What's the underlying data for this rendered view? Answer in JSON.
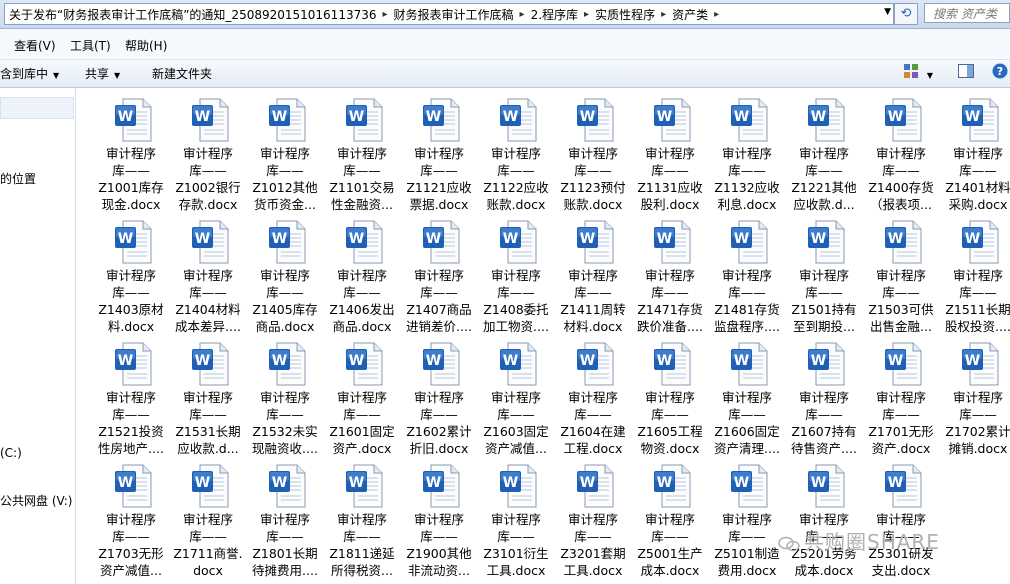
{
  "breadcrumb": [
    "关于发布“财务报表审计工作底稿”的通知_2508920151016113736",
    "财务报表审计工作底稿",
    "2.程序库",
    "实质性程序",
    "资产类"
  ],
  "search": {
    "placeholder": "搜索 资产类"
  },
  "menu": {
    "view": "查看(V)",
    "tools": "工具(T)",
    "help": "帮助(H)"
  },
  "toolbar": {
    "include": "含到库中",
    "share": "共享",
    "new_folder": "新建文件夹"
  },
  "nav": {
    "location": "的位置",
    "drive_c": "(C:)",
    "public_drive": "公共网盘 (V:)"
  },
  "watermark": "共购圈SHARE",
  "files": [
    {
      "l1": "审计程序",
      "l2": "库——",
      "l3": "Z1001库存",
      "l4": "现金.docx"
    },
    {
      "l1": "审计程序",
      "l2": "库——",
      "l3": "Z1002银行",
      "l4": "存款.docx"
    },
    {
      "l1": "审计程序",
      "l2": "库——",
      "l3": "Z1012其他",
      "l4": "货币资金..."
    },
    {
      "l1": "审计程序",
      "l2": "库——",
      "l3": "Z1101交易",
      "l4": "性金融资..."
    },
    {
      "l1": "审计程序",
      "l2": "库——",
      "l3": "Z1121应收",
      "l4": "票据.docx"
    },
    {
      "l1": "审计程序",
      "l2": "库——",
      "l3": "Z1122应收",
      "l4": "账款.docx"
    },
    {
      "l1": "审计程序",
      "l2": "库——",
      "l3": "Z1123预付",
      "l4": "账款.docx"
    },
    {
      "l1": "审计程序",
      "l2": "库——",
      "l3": "Z1131应收",
      "l4": "股利.docx"
    },
    {
      "l1": "审计程序",
      "l2": "库——",
      "l3": "Z1132应收",
      "l4": "利息.docx"
    },
    {
      "l1": "审计程序",
      "l2": "库——",
      "l3": "Z1221其他",
      "l4": "应收款.d..."
    },
    {
      "l1": "审计程序",
      "l2": "库——",
      "l3": "Z1400存货",
      "l4": "（报表项..."
    },
    {
      "l1": "审计程序",
      "l2": "库——",
      "l3": "Z1401材料",
      "l4": "采购.docx"
    },
    {
      "l1": "审计程序",
      "l2": "库——",
      "l3": "Z1403原材",
      "l4": "料.docx"
    },
    {
      "l1": "审计程序",
      "l2": "库——",
      "l3": "Z1404材料",
      "l4": "成本差异...."
    },
    {
      "l1": "审计程序",
      "l2": "库——",
      "l3": "Z1405库存",
      "l4": "商品.docx"
    },
    {
      "l1": "审计程序",
      "l2": "库——",
      "l3": "Z1406发出",
      "l4": "商品.docx"
    },
    {
      "l1": "审计程序",
      "l2": "库——",
      "l3": "Z1407商品",
      "l4": "进销差价...."
    },
    {
      "l1": "审计程序",
      "l2": "库——",
      "l3": "Z1408委托",
      "l4": "加工物资...."
    },
    {
      "l1": "审计程序",
      "l2": "库——",
      "l3": "Z1411周转",
      "l4": "材料.docx"
    },
    {
      "l1": "审计程序",
      "l2": "库——",
      "l3": "Z1471存货",
      "l4": "跌价准备...."
    },
    {
      "l1": "审计程序",
      "l2": "库——",
      "l3": "Z1481存货",
      "l4": "监盘程序...."
    },
    {
      "l1": "审计程序",
      "l2": "库——",
      "l3": "Z1501持有",
      "l4": "至到期投..."
    },
    {
      "l1": "审计程序",
      "l2": "库——",
      "l3": "Z1503可供",
      "l4": "出售金融..."
    },
    {
      "l1": "审计程序",
      "l2": "库——",
      "l3": "Z1511长期",
      "l4": "股权投资...."
    },
    {
      "l1": "审计程序",
      "l2": "库——",
      "l3": "Z1521投资",
      "l4": "性房地产...."
    },
    {
      "l1": "审计程序",
      "l2": "库——",
      "l3": "Z1531长期",
      "l4": "应收款.d..."
    },
    {
      "l1": "审计程序",
      "l2": "库——",
      "l3": "Z1532未实",
      "l4": "现融资收...."
    },
    {
      "l1": "审计程序",
      "l2": "库——",
      "l3": "Z1601固定",
      "l4": "资产.docx"
    },
    {
      "l1": "审计程序",
      "l2": "库——",
      "l3": "Z1602累计",
      "l4": "折旧.docx"
    },
    {
      "l1": "审计程序",
      "l2": "库——",
      "l3": "Z1603固定",
      "l4": "资产减值..."
    },
    {
      "l1": "审计程序",
      "l2": "库——",
      "l3": "Z1604在建",
      "l4": "工程.docx"
    },
    {
      "l1": "审计程序",
      "l2": "库——",
      "l3": "Z1605工程",
      "l4": "物资.docx"
    },
    {
      "l1": "审计程序",
      "l2": "库——",
      "l3": "Z1606固定",
      "l4": "资产清理...."
    },
    {
      "l1": "审计程序",
      "l2": "库——",
      "l3": "Z1607持有",
      "l4": "待售资产...."
    },
    {
      "l1": "审计程序",
      "l2": "库——",
      "l3": "Z1701无形",
      "l4": "资产.docx"
    },
    {
      "l1": "审计程序",
      "l2": "库——",
      "l3": "Z1702累计",
      "l4": "摊销.docx"
    },
    {
      "l1": "审计程序",
      "l2": "库——",
      "l3": "Z1703无形",
      "l4": "资产减值..."
    },
    {
      "l1": "审计程序",
      "l2": "库——",
      "l3": "Z1711商誉.",
      "l4": "docx"
    },
    {
      "l1": "审计程序",
      "l2": "库——",
      "l3": "Z1801长期",
      "l4": "待摊费用...."
    },
    {
      "l1": "审计程序",
      "l2": "库——",
      "l3": "Z1811递延",
      "l4": "所得税资..."
    },
    {
      "l1": "审计程序",
      "l2": "库——",
      "l3": "Z1900其他",
      "l4": "非流动资..."
    },
    {
      "l1": "审计程序",
      "l2": "库——",
      "l3": "Z3101衍生",
      "l4": "工具.docx"
    },
    {
      "l1": "审计程序",
      "l2": "库——",
      "l3": "Z3201套期",
      "l4": "工具.docx"
    },
    {
      "l1": "审计程序",
      "l2": "库——",
      "l3": "Z5001生产",
      "l4": "成本.docx"
    },
    {
      "l1": "审计程序",
      "l2": "库——",
      "l3": "Z5101制造",
      "l4": "费用.docx"
    },
    {
      "l1": "审计程序",
      "l2": "库——",
      "l3": "Z5201劳务",
      "l4": "成本.docx"
    },
    {
      "l1": "审计程序",
      "l2": "库——",
      "l3": "Z5301研发",
      "l4": "支出.docx"
    }
  ]
}
